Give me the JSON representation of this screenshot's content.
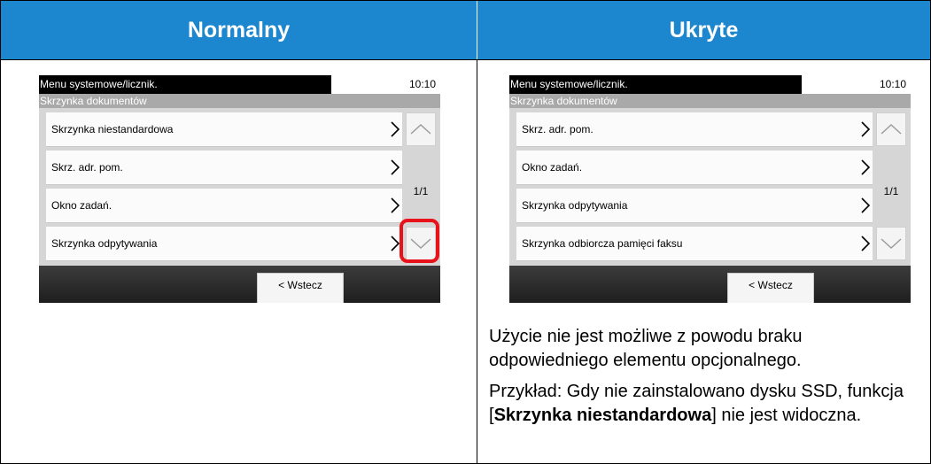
{
  "columns": {
    "normal_header": "Normalny",
    "hidden_header": "Ukryte"
  },
  "screen_left": {
    "title": "Menu systemowe/licznik.",
    "time": "10:10",
    "subtitle": "Skrzynka dokumentów",
    "items": [
      "Skrzynka niestandardowa",
      "Skrz. adr. pom.",
      "Okno zadań.",
      "Skrzynka odpytywania"
    ],
    "page_indicator": "1/1",
    "back_button": "< Wstecz"
  },
  "screen_right": {
    "title": "Menu systemowe/licznik.",
    "time": "10:10",
    "subtitle": "Skrzynka dokumentów",
    "items": [
      "Skrz. adr. pom.",
      "Okno zadań.",
      "Skrzynka odpytywania",
      "Skrzynka odbiorcza pamięci faksu"
    ],
    "page_indicator": "1/1",
    "back_button": "< Wstecz"
  },
  "description": {
    "line1": "Użycie nie jest możliwe z powodu braku odpowiedniego elementu opcjonalnego.",
    "example_prefix": "Przykład: Gdy nie zainstalowano dysku SSD, funkcja [",
    "example_bold": "Skrzynka niestandardowa",
    "example_suffix": "] nie jest widoczna."
  },
  "colors": {
    "header_bg": "#1c87cf",
    "highlight": "#e8121b"
  }
}
